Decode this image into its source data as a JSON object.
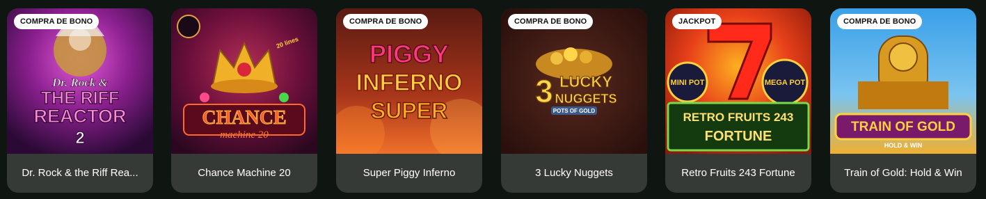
{
  "games": [
    {
      "title": "Dr. Rock & the Riff Rea...",
      "badge": "COMPRA DE BONO",
      "art_text": [
        "Dr. Rock &",
        "THE RIFF",
        "REACTOR",
        "2"
      ]
    },
    {
      "title": "Chance Machine 20",
      "badge": "",
      "art_text": [
        "CHANCE",
        "machine 20",
        "20 lines"
      ]
    },
    {
      "title": "Super Piggy Inferno",
      "badge": "COMPRA DE BONO",
      "art_text": [
        "PIGGY",
        "INFERNO",
        "SUPER"
      ]
    },
    {
      "title": "3 Lucky Nuggets",
      "badge": "COMPRA DE BONO",
      "art_text": [
        "3",
        "LUCKY",
        "NUGGETS",
        "POTS OF GOLD"
      ]
    },
    {
      "title": "Retro Fruits 243 Fortune",
      "badge": "JACKPOT",
      "art_text": [
        "MINI POT",
        "MEGA POT",
        "RETRO FRUITS 243",
        "FORTUNE"
      ]
    },
    {
      "title": "Train of Gold: Hold & Win",
      "badge": "COMPRA DE BONO",
      "art_text": [
        "TRAIN OF GOLD",
        "HOLD & WIN"
      ]
    }
  ]
}
